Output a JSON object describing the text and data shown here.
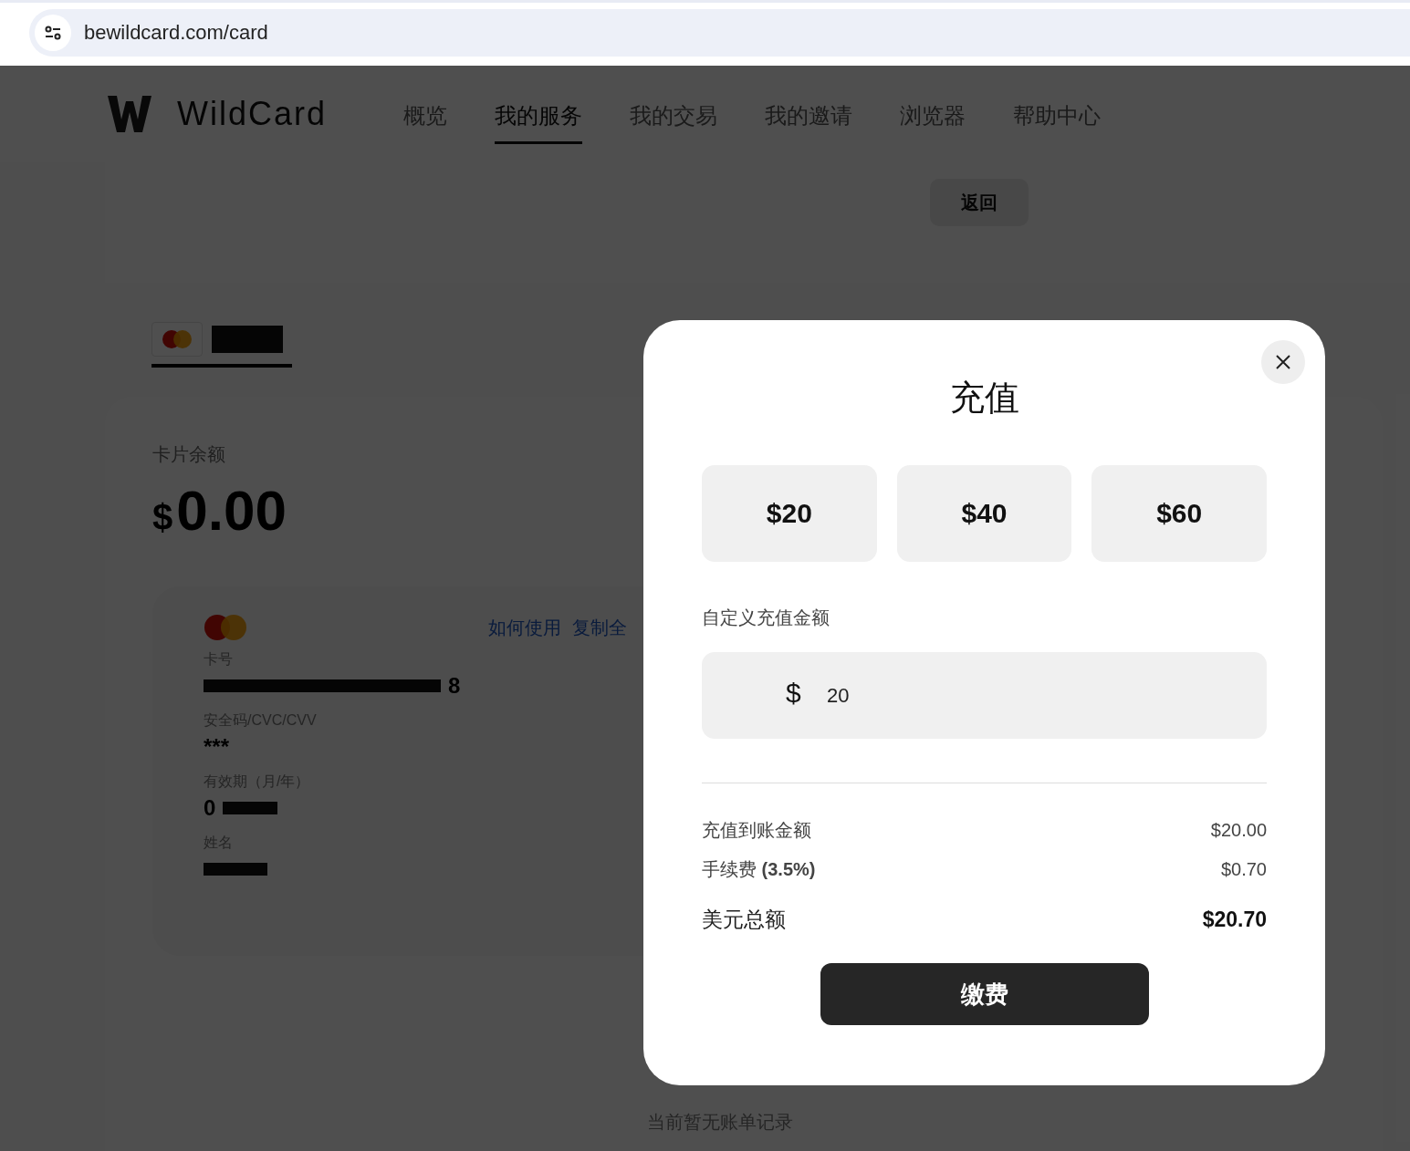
{
  "browser": {
    "url": "bewildcard.com/card"
  },
  "header": {
    "brand": "WildCard",
    "nav": [
      {
        "label": "概览",
        "selected": false
      },
      {
        "label": "我的服务",
        "selected": true
      },
      {
        "label": "我的交易",
        "selected": false
      },
      {
        "label": "我的邀请",
        "selected": false
      },
      {
        "label": "浏览器",
        "selected": false
      },
      {
        "label": "帮助中心",
        "selected": false
      }
    ]
  },
  "back_button": "返回",
  "card_tabs": [
    {
      "selected": true
    }
  ],
  "balance": {
    "label": "卡片余额",
    "currency": "$",
    "amount": "0.00"
  },
  "card": {
    "links": [
      "如何使用",
      "复制全"
    ],
    "fields": [
      {
        "label": "卡号",
        "value_tail": "8",
        "kind": "number"
      },
      {
        "label": "安全码/CVC/CVV",
        "value": "***",
        "kind": "plain"
      },
      {
        "label": "有效期（月/年）",
        "value_head": "0",
        "kind": "expiry"
      },
      {
        "label": "姓名",
        "kind": "name"
      }
    ]
  },
  "empty_text": "当前暂无账单记录",
  "modal": {
    "title": "充值",
    "presets": [
      {
        "label": "$20",
        "selected": false
      },
      {
        "label": "$40",
        "selected": false
      },
      {
        "label": "$60",
        "selected": false
      }
    ],
    "custom_label": "自定义充值金额",
    "currency": "$",
    "value": "20",
    "summary": [
      {
        "label": "充值到账金额",
        "value": "$20.00",
        "kind": "normal"
      },
      {
        "label": "手续费 **(3.5%)**",
        "value": "$0.70",
        "kind": "normal"
      },
      {
        "label": "美元总额",
        "value": "$20.70",
        "kind": "total"
      }
    ],
    "pay_button": "缴费"
  }
}
